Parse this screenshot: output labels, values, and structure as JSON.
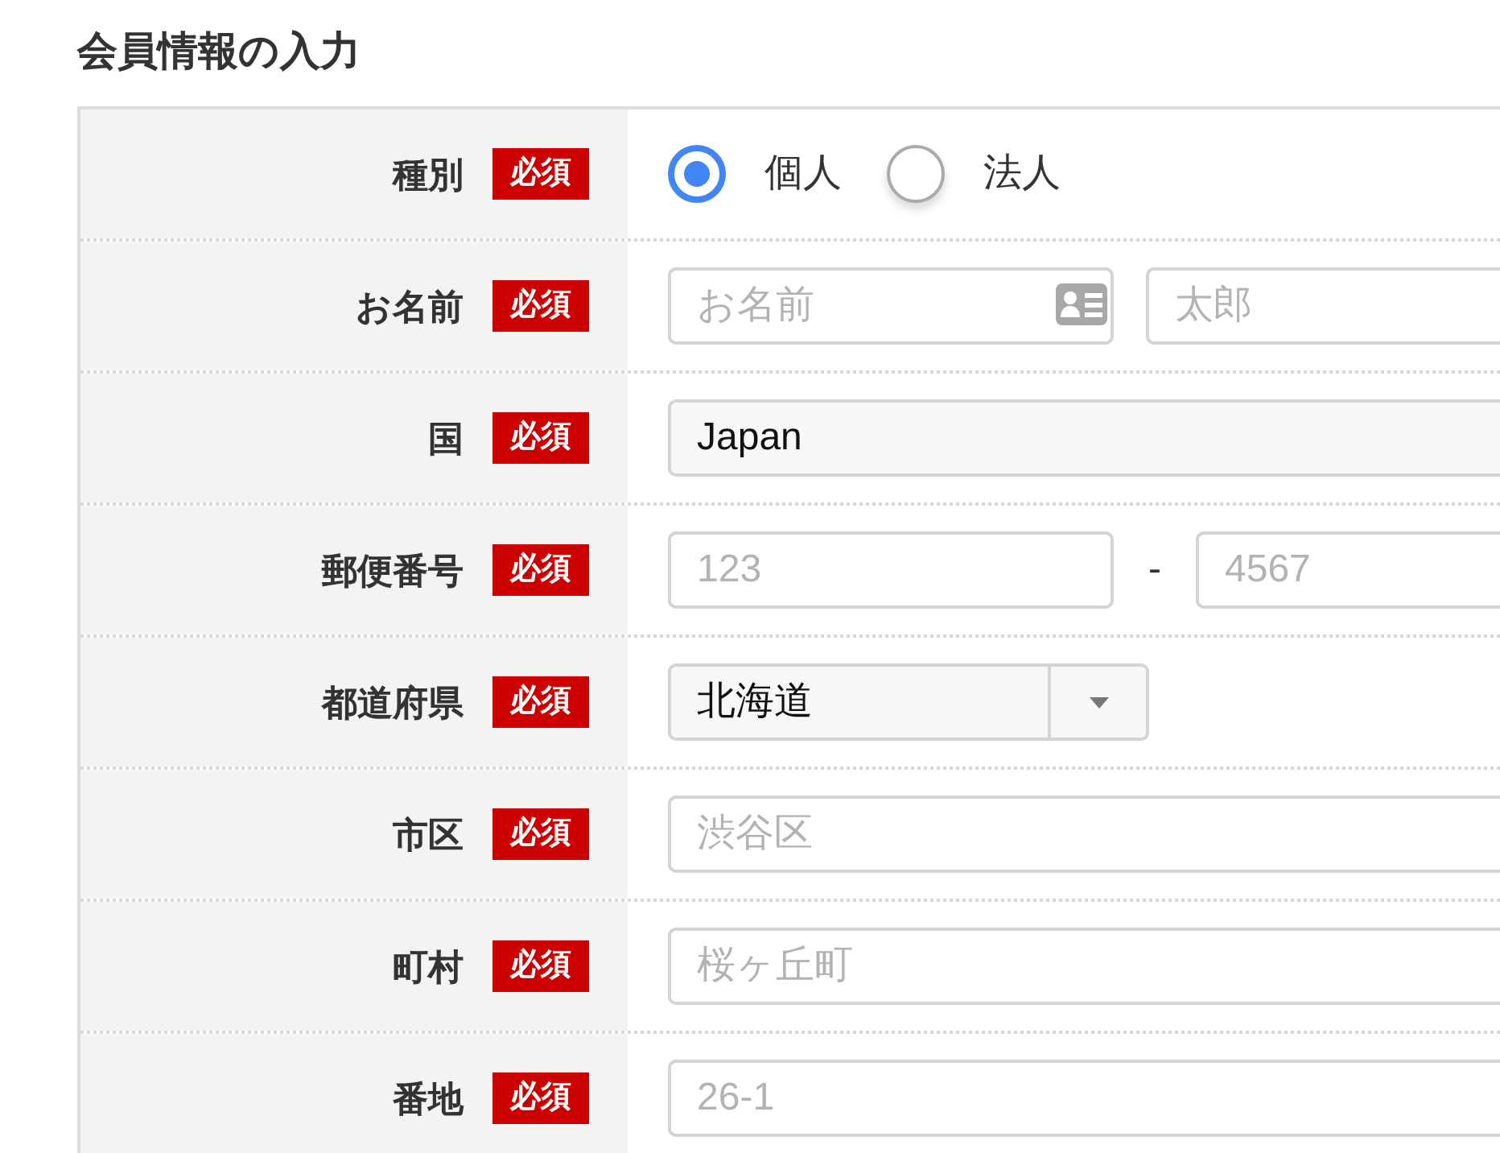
{
  "title": "会員情報の入力",
  "rows": [
    {
      "label": "種別",
      "badge": "必須",
      "kind": "radio",
      "options": [
        {
          "label": "個人",
          "selected": true
        },
        {
          "label": "法人",
          "selected": false
        }
      ]
    },
    {
      "label": "お名前",
      "badge": "必須",
      "kind": "name",
      "fields": [
        {
          "placeholder": "お名前"
        },
        {
          "placeholder": "太郎"
        }
      ]
    },
    {
      "label": "国",
      "badge": "必須",
      "kind": "select",
      "value": "Japan"
    },
    {
      "label": "郵便番号",
      "badge": "必須",
      "kind": "postal",
      "separator": "-",
      "fields": [
        {
          "placeholder": "123"
        },
        {
          "placeholder": "4567"
        }
      ]
    },
    {
      "label": "都道府県",
      "badge": "必須",
      "kind": "dropdown",
      "value": "北海道"
    },
    {
      "label": "市区",
      "badge": "必須",
      "kind": "text",
      "placeholder": "渋谷区"
    },
    {
      "label": "町村",
      "badge": "必須",
      "kind": "text",
      "placeholder": "桜ヶ丘町"
    },
    {
      "label": "番地",
      "badge": "必須",
      "kind": "text",
      "placeholder": "26-1"
    }
  ]
}
